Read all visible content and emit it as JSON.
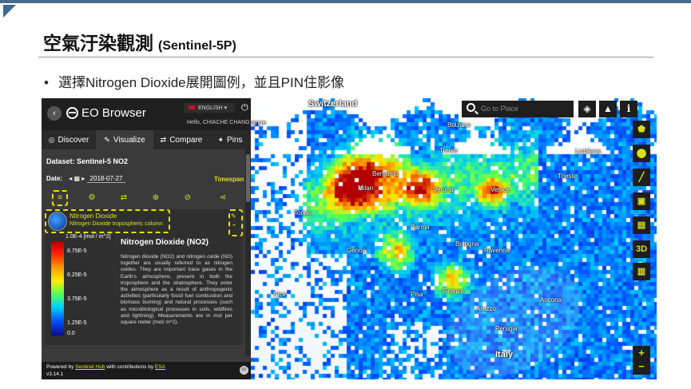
{
  "slide": {
    "title": "空氣汙染觀測",
    "title_sub": "(Sentinel-5P)",
    "bullet": "選擇Nitrogen Dioxide展開圖例，並且PIN住影像"
  },
  "app": {
    "name": "EO Browser",
    "language": "ENGLISH",
    "user": "Hello, CHIACHE CHANG"
  },
  "tabs": [
    {
      "label": "Discover",
      "icon": "globe-icon"
    },
    {
      "label": "Visualize",
      "icon": "brush-icon"
    },
    {
      "label": "Compare",
      "icon": "swap-icon"
    },
    {
      "label": "Pins",
      "icon": "pin-icon"
    }
  ],
  "dataset": "Dataset: Sentinel-5 NO2",
  "date": {
    "label": "Date:",
    "value": "2018-07-27"
  },
  "timespan": "Timespan",
  "layer": {
    "name": "Nitrogen Dioxide",
    "description": "Nitrogen Dioxide tropospheric column"
  },
  "legend": {
    "unit": "1.0E-4 [mol / m^2]",
    "ticks": [
      "8.75E-5",
      "6.25E-5",
      "3.75E-5",
      "1.25E-5",
      "0.0"
    ],
    "title": "Nitrogen Dioxide (NO2)",
    "text": "Nitrogen dioxide (NO2) and nitrogen oxide (NO) together are usually referred to as nitrogen oxides. They are important trace gases in the Earth's atmosphere, present in both the troposphere and the stratosphere. They enter the atmosphere as a result of anthropogenic activities (particularly fossil fuel combustion and biomass burning) and natural processes (such as microbiological processes in soils, wildfires and lightning). Measurements are in mol per square meter (mol/ m^2)."
  },
  "footer": {
    "powered": "Powered by",
    "sentinel_hub": "Sentinel Hub",
    "contrib": "with contributions by",
    "esa": "ESA",
    "version": "v3.14.1"
  },
  "map": {
    "search_placeholder": "Go to Place",
    "places": [
      {
        "name": "Switzerland",
        "big": true
      },
      {
        "name": "Lausanne"
      },
      {
        "name": "Bolzano"
      },
      {
        "name": "Trento"
      },
      {
        "name": "Ljubljana"
      },
      {
        "name": "Bergamo"
      },
      {
        "name": "Milan"
      },
      {
        "name": "Verona"
      },
      {
        "name": "Venice"
      },
      {
        "name": "Trieste"
      },
      {
        "name": "Torino"
      },
      {
        "name": "Parma"
      },
      {
        "name": "Bologna"
      },
      {
        "name": "Ravenna"
      },
      {
        "name": "Genoa"
      },
      {
        "name": "Firenze"
      },
      {
        "name": "Nice"
      },
      {
        "name": "Pisa"
      },
      {
        "name": "Arezzo"
      },
      {
        "name": "Ancona"
      },
      {
        "name": "Perugia"
      },
      {
        "name": "Italy",
        "big": true
      }
    ],
    "right_toolbar": [
      "area-icon",
      "location-icon",
      "measure-icon",
      "image-download-icon",
      "timelapse-icon",
      "3D",
      "chart-icon"
    ],
    "zoom_in": "+",
    "zoom_out": "−"
  }
}
